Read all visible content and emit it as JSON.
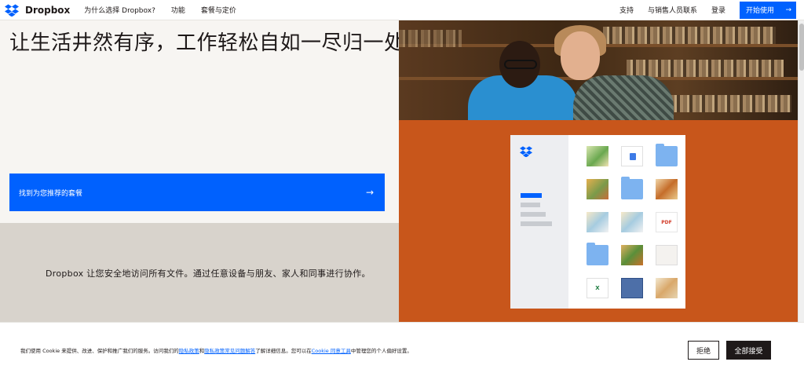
{
  "header": {
    "brand": "Dropbox",
    "nav_left": [
      "为什么选择 Dropbox?",
      "功能",
      "套餐与定价"
    ],
    "nav_right": [
      "支持",
      "与销售人员联系",
      "登录"
    ],
    "cta": "开始使用",
    "cta_arrow": "→"
  },
  "hero": {
    "title": "让生活井然有序，工作轻松自如一尽归一处",
    "plan_button": "找到为您推荐的套餐",
    "plan_arrow": "→",
    "description": "Dropbox 让您安全地访问所有文件。通过任意设备与朋友、家人和同事进行协作。"
  },
  "mockup": {
    "pdf_label": "PDF",
    "xls_label": "X"
  },
  "cookie": {
    "text_1": "我们使用 Cookie 来提供、改进、保护和推广我们的服务。访问我们的",
    "link_privacy": "隐私政策",
    "text_2": "和",
    "link_faq": "隐私政策常见问题解答",
    "text_3": "了解详细信息。您可以在",
    "link_tool": "Cookie 同意工具",
    "text_4": "中管理您的个人偏好设置。",
    "reject": "拒绝",
    "accept": "全部接受"
  },
  "colors": {
    "brand_blue": "#0061fe",
    "orange": "#c8561b",
    "beige": "#d8d3cc",
    "dark": "#1e1919"
  }
}
